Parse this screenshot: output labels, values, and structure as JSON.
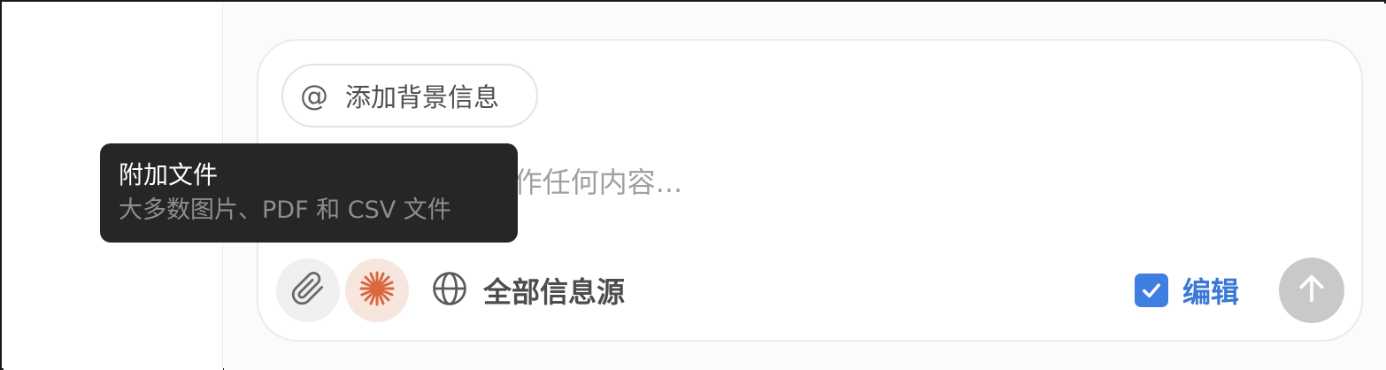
{
  "composer": {
    "context_chip": {
      "icon": "at-icon",
      "symbol": "@",
      "label": "添加背景信息"
    },
    "prompt": {
      "value": "",
      "placeholder": "要求 Notion AI 制作任何内容..."
    },
    "toolbar": {
      "attach": {
        "icon": "paperclip-icon"
      },
      "ai": {
        "icon": "notion-ai-spark-icon",
        "color": "#d9673f"
      },
      "sources": {
        "icon": "globe-icon",
        "label": "全部信息源"
      },
      "edit": {
        "label": "编辑",
        "checked": true,
        "color": "#3f7fe0"
      },
      "send": {
        "icon": "arrow-up-icon"
      }
    }
  },
  "tooltip": {
    "title": "附加文件",
    "subtitle": "大多数图片、PDF 和 CSV 文件"
  }
}
